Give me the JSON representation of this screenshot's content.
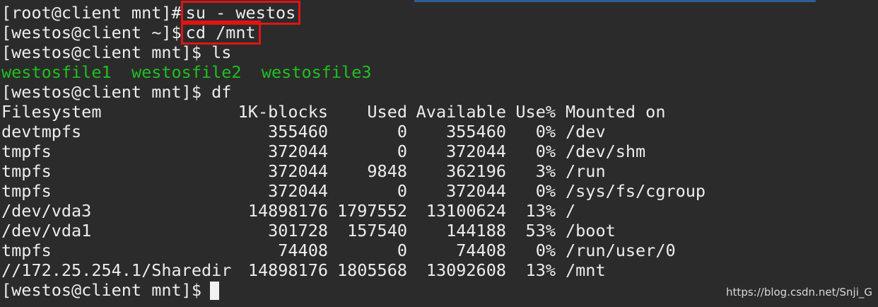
{
  "terminal": {
    "commands": [
      {
        "prompt": "[root@client mnt]#",
        "command": "su - westos"
      },
      {
        "prompt": "[westos@client ~]$",
        "command": "cd /mnt"
      },
      {
        "prompt": "[westos@client mnt]$",
        "command": "ls"
      }
    ],
    "ls_files": [
      "westosfile1",
      "westosfile2",
      "westosfile3"
    ],
    "df_command": {
      "prompt": "[westos@client mnt]$",
      "command": "df"
    },
    "df_headers": [
      "Filesystem",
      "1K-blocks",
      "Used",
      "Available",
      "Use%",
      "Mounted on"
    ],
    "df_rows": [
      [
        "devtmpfs",
        "355460",
        "0",
        "355460",
        "0%",
        "/dev"
      ],
      [
        "tmpfs",
        "372044",
        "0",
        "372044",
        "0%",
        "/dev/shm"
      ],
      [
        "tmpfs",
        "372044",
        "9848",
        "362196",
        "3%",
        "/run"
      ],
      [
        "tmpfs",
        "372044",
        "0",
        "372044",
        "0%",
        "/sys/fs/cgroup"
      ],
      [
        "/dev/vda3",
        "14898176",
        "1797552",
        "13100624",
        "13%",
        "/"
      ],
      [
        "/dev/vda1",
        "301728",
        "157540",
        "144188",
        "53%",
        "/boot"
      ],
      [
        "tmpfs",
        "74408",
        "0",
        "74408",
        "0%",
        "/run/user/0"
      ],
      [
        "//172.25.254.1/Sharedir",
        "14898176",
        "1805568",
        "13092608",
        "13%",
        "/mnt"
      ]
    ],
    "final_prompt": "[westos@client mnt]$"
  },
  "watermark": "https://blog.csdn.net/Snji_G",
  "colors": {
    "background": "#2b2b2b",
    "text": "#ededed",
    "file_green": "#1fc01f",
    "highlight_box": "#e01414"
  }
}
